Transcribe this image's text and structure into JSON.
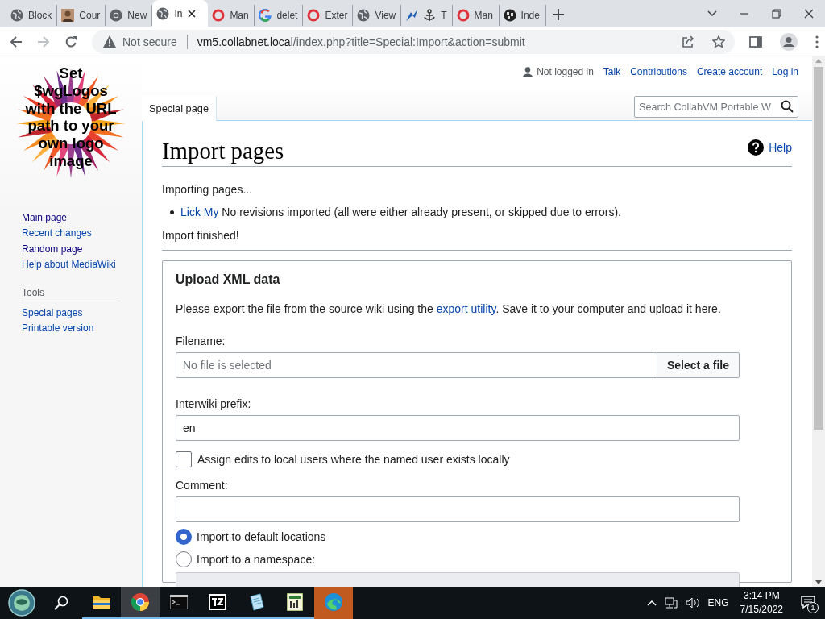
{
  "browser": {
    "tabs": [
      {
        "kind": "globe",
        "title": "Block",
        "selected": false
      },
      {
        "kind": "photo",
        "title": "Cour",
        "selected": false
      },
      {
        "kind": "chrome",
        "title": "New",
        "selected": false
      },
      {
        "kind": "globe",
        "title": "In",
        "selected": true
      },
      {
        "kind": "ring",
        "title": "Man",
        "selected": false
      },
      {
        "kind": "google",
        "title": "delet",
        "selected": false
      },
      {
        "kind": "ring",
        "title": "Exter",
        "selected": false
      },
      {
        "kind": "globe",
        "title": "View",
        "selected": false
      },
      {
        "kind": "anchor",
        "title": "T",
        "selected": false
      },
      {
        "kind": "ring",
        "title": "Man",
        "selected": false
      },
      {
        "kind": "wiki",
        "title": "Inde",
        "selected": false
      }
    ],
    "forward_disabled": true,
    "security": "Not secure",
    "url_host": "vm5.collabnet.local",
    "url_path": "/index.php?title=Special:Import&action=submit"
  },
  "wiki": {
    "logo_lines": [
      "Set",
      "$wgLogos",
      "with the URL",
      "path to your",
      "own logo",
      "image"
    ],
    "navigation": [
      {
        "label": "Main page",
        "visited": true
      },
      {
        "label": "Recent changes",
        "visited": false
      },
      {
        "label": "Random page",
        "visited": true
      },
      {
        "label": "Help about MediaWiki",
        "visited": false
      }
    ],
    "tools_heading": "Tools",
    "tools": [
      {
        "label": "Special pages",
        "visited": false
      },
      {
        "label": "Printable version",
        "visited": false
      }
    ],
    "user_status": "Not logged in",
    "personal_links": [
      "Talk",
      "Contributions",
      "Create account",
      "Log in"
    ],
    "page_tab": "Special page",
    "search": {
      "placeholder": "Search CollabVM Portable W"
    },
    "title": "Import pages",
    "help": "Help",
    "messages": {
      "intro": "Importing pages...",
      "results": [
        {
          "page": "Lick My",
          "text": " No revisions imported (all were either already present, or skipped due to errors)."
        }
      ],
      "finished": "Import finished!"
    },
    "form": {
      "legend": "Upload XML data",
      "intro_before": "Please export the file from the source wiki using the ",
      "intro_link": "export utility",
      "intro_after": ". Save it to your computer and upload it here.",
      "filename_label": "Filename:",
      "file_placeholder": "No file is selected",
      "file_button": "Select a file",
      "interwiki_label": "Interwiki prefix:",
      "interwiki_value": "en",
      "assign_edits": {
        "label": "Assign edits to local users where the named user exists locally",
        "checked": false
      },
      "comment_label": "Comment:",
      "destinations": [
        {
          "label": "Import to default locations",
          "selected": true
        },
        {
          "label": "Import to a namespace:",
          "selected": false
        }
      ],
      "namespace_select": {
        "disabled": true
      }
    }
  },
  "taskbar": {
    "apps": [
      {
        "kind": "explorer",
        "active": false,
        "alert": false
      },
      {
        "kind": "chrome",
        "active": true,
        "alert": false
      },
      {
        "kind": "terminal",
        "active": false,
        "alert": false
      },
      {
        "kind": "archiver",
        "active": false,
        "alert": false
      },
      {
        "kind": "notepad",
        "active": false,
        "alert": false
      },
      {
        "kind": "sheet",
        "active": false,
        "alert": false
      },
      {
        "kind": "edge",
        "active": false,
        "alert": true
      }
    ],
    "language": "ENG",
    "time": "3:14 PM",
    "date": "7/15/2022",
    "notifications": "1"
  }
}
